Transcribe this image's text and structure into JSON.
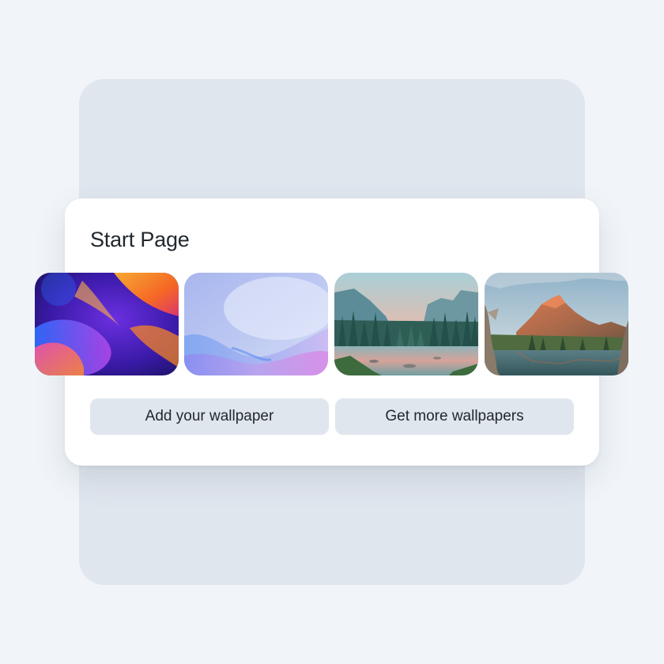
{
  "start_page": {
    "title": "Start Page",
    "wallpapers": [
      {
        "icon": "abstract-color-wallpaper"
      },
      {
        "icon": "lavender-wave-wallpaper"
      },
      {
        "icon": "forest-river-wallpaper"
      },
      {
        "icon": "mountain-lake-wallpaper"
      }
    ],
    "add_label": "Add your wallpaper",
    "more_label": "Get more wallpapers"
  }
}
